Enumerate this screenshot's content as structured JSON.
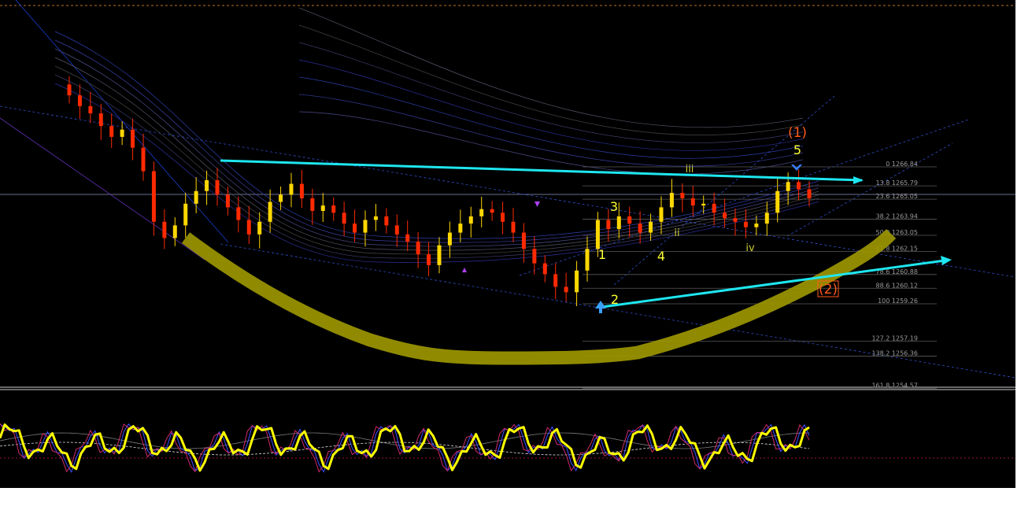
{
  "chart_data": {
    "type": "candlestick",
    "price_range": [
      1253.5,
      1271.5
    ],
    "colors": {
      "background": "#000000",
      "bull": "#ffd700",
      "bear": "#ff2a00",
      "trendline": "#1ee6f0",
      "channel": "#2f5fe0",
      "cup": "#9c9600",
      "oscillator": "#ffff00"
    },
    "fib_levels": [
      {
        "pct": "0",
        "price": "1266.84",
        "value": 1266.84
      },
      {
        "pct": "13.8",
        "price": "1265.79",
        "value": 1265.79
      },
      {
        "pct": "23.6",
        "price": "1265.05",
        "value": 1265.05
      },
      {
        "pct": "38.2",
        "price": "1263.94",
        "value": 1263.94
      },
      {
        "pct": "50.0",
        "price": "1263.05",
        "value": 1263.05
      },
      {
        "pct": "61.8",
        "price": "1262.15",
        "value": 1262.15
      },
      {
        "pct": "78.6",
        "price": "1260.88",
        "value": 1260.88
      },
      {
        "pct": "88.6",
        "price": "1260.12",
        "value": 1260.12
      },
      {
        "pct": "100",
        "price": "1259.26",
        "value": 1259.26
      },
      {
        "pct": "127.2",
        "price": "1257.19",
        "value": 1257.19
      },
      {
        "pct": "138.2",
        "price": "1256.36",
        "value": 1256.36
      },
      {
        "pct": "161.8",
        "price": "1254.57",
        "value": 1254.57
      }
    ],
    "wave_labels": [
      {
        "text": "(1)",
        "style": "red"
      },
      {
        "text": "5",
        "style": "yellow"
      },
      {
        "text": "3",
        "style": "yellow"
      },
      {
        "text": "1",
        "style": "yellow"
      },
      {
        "text": "2",
        "style": "yellow"
      },
      {
        "text": "4",
        "style": "yellow"
      },
      {
        "text": "(2)",
        "style": "red-box"
      },
      {
        "text": "iii",
        "style": "roman"
      },
      {
        "text": "ii",
        "style": "roman"
      },
      {
        "text": "iv",
        "style": "roman"
      }
    ],
    "candles_close_path": [
      1270.8,
      1270.2,
      1269.8,
      1269.1,
      1268.5,
      1268.9,
      1267.9,
      1266.6,
      1263.8,
      1262.9,
      1263.6,
      1264.8,
      1265.5,
      1266.1,
      1265.3,
      1264.6,
      1263.9,
      1263.1,
      1263.8,
      1264.9,
      1265.3,
      1265.9,
      1265.1,
      1264.4,
      1264.7,
      1264.3,
      1263.7,
      1263.2,
      1263.9,
      1264.1,
      1263.6,
      1263.1,
      1262.7,
      1262.0,
      1261.4,
      1262.5,
      1263.2,
      1263.7,
      1264.1,
      1264.5,
      1264.3,
      1263.8,
      1263.2,
      1262.3,
      1261.5,
      1260.9,
      1260.2,
      1259.9,
      1261.1,
      1262.3,
      1263.9,
      1263.4,
      1264.1,
      1263.7,
      1263.2,
      1263.8,
      1264.6,
      1265.4,
      1265.1,
      1264.7,
      1264.8,
      1264.3,
      1264.0,
      1263.8,
      1263.5,
      1263.7,
      1264.3,
      1265.5,
      1266.0,
      1265.6,
      1265.1
    ]
  }
}
